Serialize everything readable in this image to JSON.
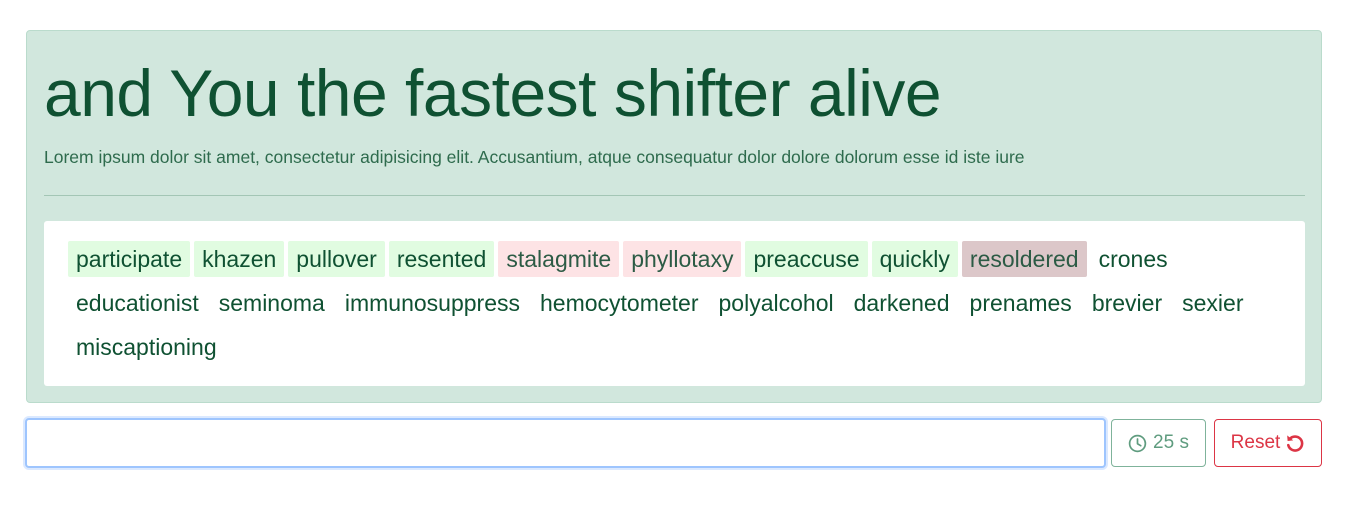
{
  "header": {
    "title": "and You the fastest shifter alive",
    "subtitle": "Lorem ipsum dolor sit amet, consectetur adipisicing elit. Accusantium, atque consequatur dolor dolore dolorum esse id iste iure"
  },
  "words": [
    {
      "text": "participate",
      "state": "correct"
    },
    {
      "text": "khazen",
      "state": "correct"
    },
    {
      "text": "pullover",
      "state": "correct"
    },
    {
      "text": "resented",
      "state": "correct"
    },
    {
      "text": "stalagmite",
      "state": "incorrect"
    },
    {
      "text": "phyllotaxy",
      "state": "incorrect"
    },
    {
      "text": "preaccuse",
      "state": "correct"
    },
    {
      "text": "quickly",
      "state": "correct"
    },
    {
      "text": "resoldered",
      "state": "current"
    },
    {
      "text": "crones",
      "state": "pending"
    },
    {
      "text": "educationist",
      "state": "pending"
    },
    {
      "text": "seminoma",
      "state": "pending"
    },
    {
      "text": "immunosuppress",
      "state": "pending"
    },
    {
      "text": "hemocytometer",
      "state": "pending"
    },
    {
      "text": "polyalcohol",
      "state": "pending"
    },
    {
      "text": "darkened",
      "state": "pending"
    },
    {
      "text": "prenames",
      "state": "pending"
    },
    {
      "text": "brevier",
      "state": "pending"
    },
    {
      "text": "sexier",
      "state": "pending"
    },
    {
      "text": "miscaptioning",
      "state": "pending"
    }
  ],
  "input": {
    "value": "",
    "placeholder": ""
  },
  "timer": {
    "icon": "clock-icon",
    "label": "25 s"
  },
  "reset": {
    "label": "Reset",
    "icon": "undo-icon"
  },
  "colors": {
    "panel_bg": "#d1e7dd",
    "title_text": "#0f5132",
    "correct_bg": "#e1fce1",
    "incorrect_bg": "#fde3e5",
    "current_bg": "#dcc7c9",
    "reset_red": "#dc3545",
    "focus_blue": "#9ec5fe"
  }
}
